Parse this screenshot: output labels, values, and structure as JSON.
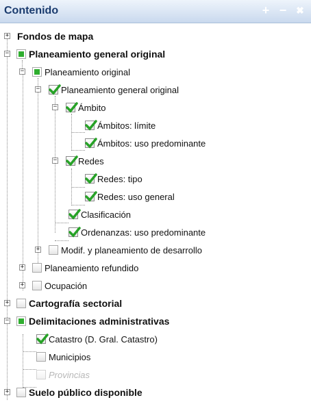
{
  "panel": {
    "title": "Contenido",
    "add_glyph": "+",
    "minimize_glyph": "−",
    "close_glyph": "✖"
  },
  "tree": [
    {
      "label": "Fondos de mapa",
      "state": "unchecked",
      "expanded": false,
      "checkbox": false
    },
    {
      "label": "Planeamiento general original",
      "state": "partial",
      "expanded": true
    },
    {
      "label": "Planeamiento original",
      "state": "partial",
      "expanded": true
    },
    {
      "label": "Planeamiento general original",
      "state": "checked",
      "expanded": true
    },
    {
      "label": "Ámbito",
      "state": "checked",
      "expanded": true
    },
    {
      "label": "Ámbitos: límite",
      "state": "checked"
    },
    {
      "label": "Ámbitos: uso predominante",
      "state": "checked"
    },
    {
      "label": "Redes",
      "state": "checked",
      "expanded": true
    },
    {
      "label": "Redes: tipo",
      "state": "checked"
    },
    {
      "label": "Redes: uso general",
      "state": "checked"
    },
    {
      "label": "Clasificación",
      "state": "checked"
    },
    {
      "label": "Ordenanzas: uso predominante",
      "state": "checked"
    },
    {
      "label": "Modif. y planeamiento de desarrollo",
      "state": "unchecked",
      "expanded": false
    },
    {
      "label": "Planeamiento refundido",
      "state": "unchecked",
      "expanded": false
    },
    {
      "label": "Ocupación",
      "state": "unchecked",
      "expanded": false
    },
    {
      "label": "Cartografía sectorial",
      "state": "unchecked",
      "expanded": false
    },
    {
      "label": "Delimitaciones administrativas",
      "state": "partial",
      "expanded": true
    },
    {
      "label": "Catastro (D. Gral. Catastro)",
      "state": "checked"
    },
    {
      "label": "Municipios",
      "state": "unchecked"
    },
    {
      "label": "Provincias",
      "state": "disabled"
    },
    {
      "label": "Suelo público disponible",
      "state": "unchecked",
      "expanded": false
    }
  ]
}
